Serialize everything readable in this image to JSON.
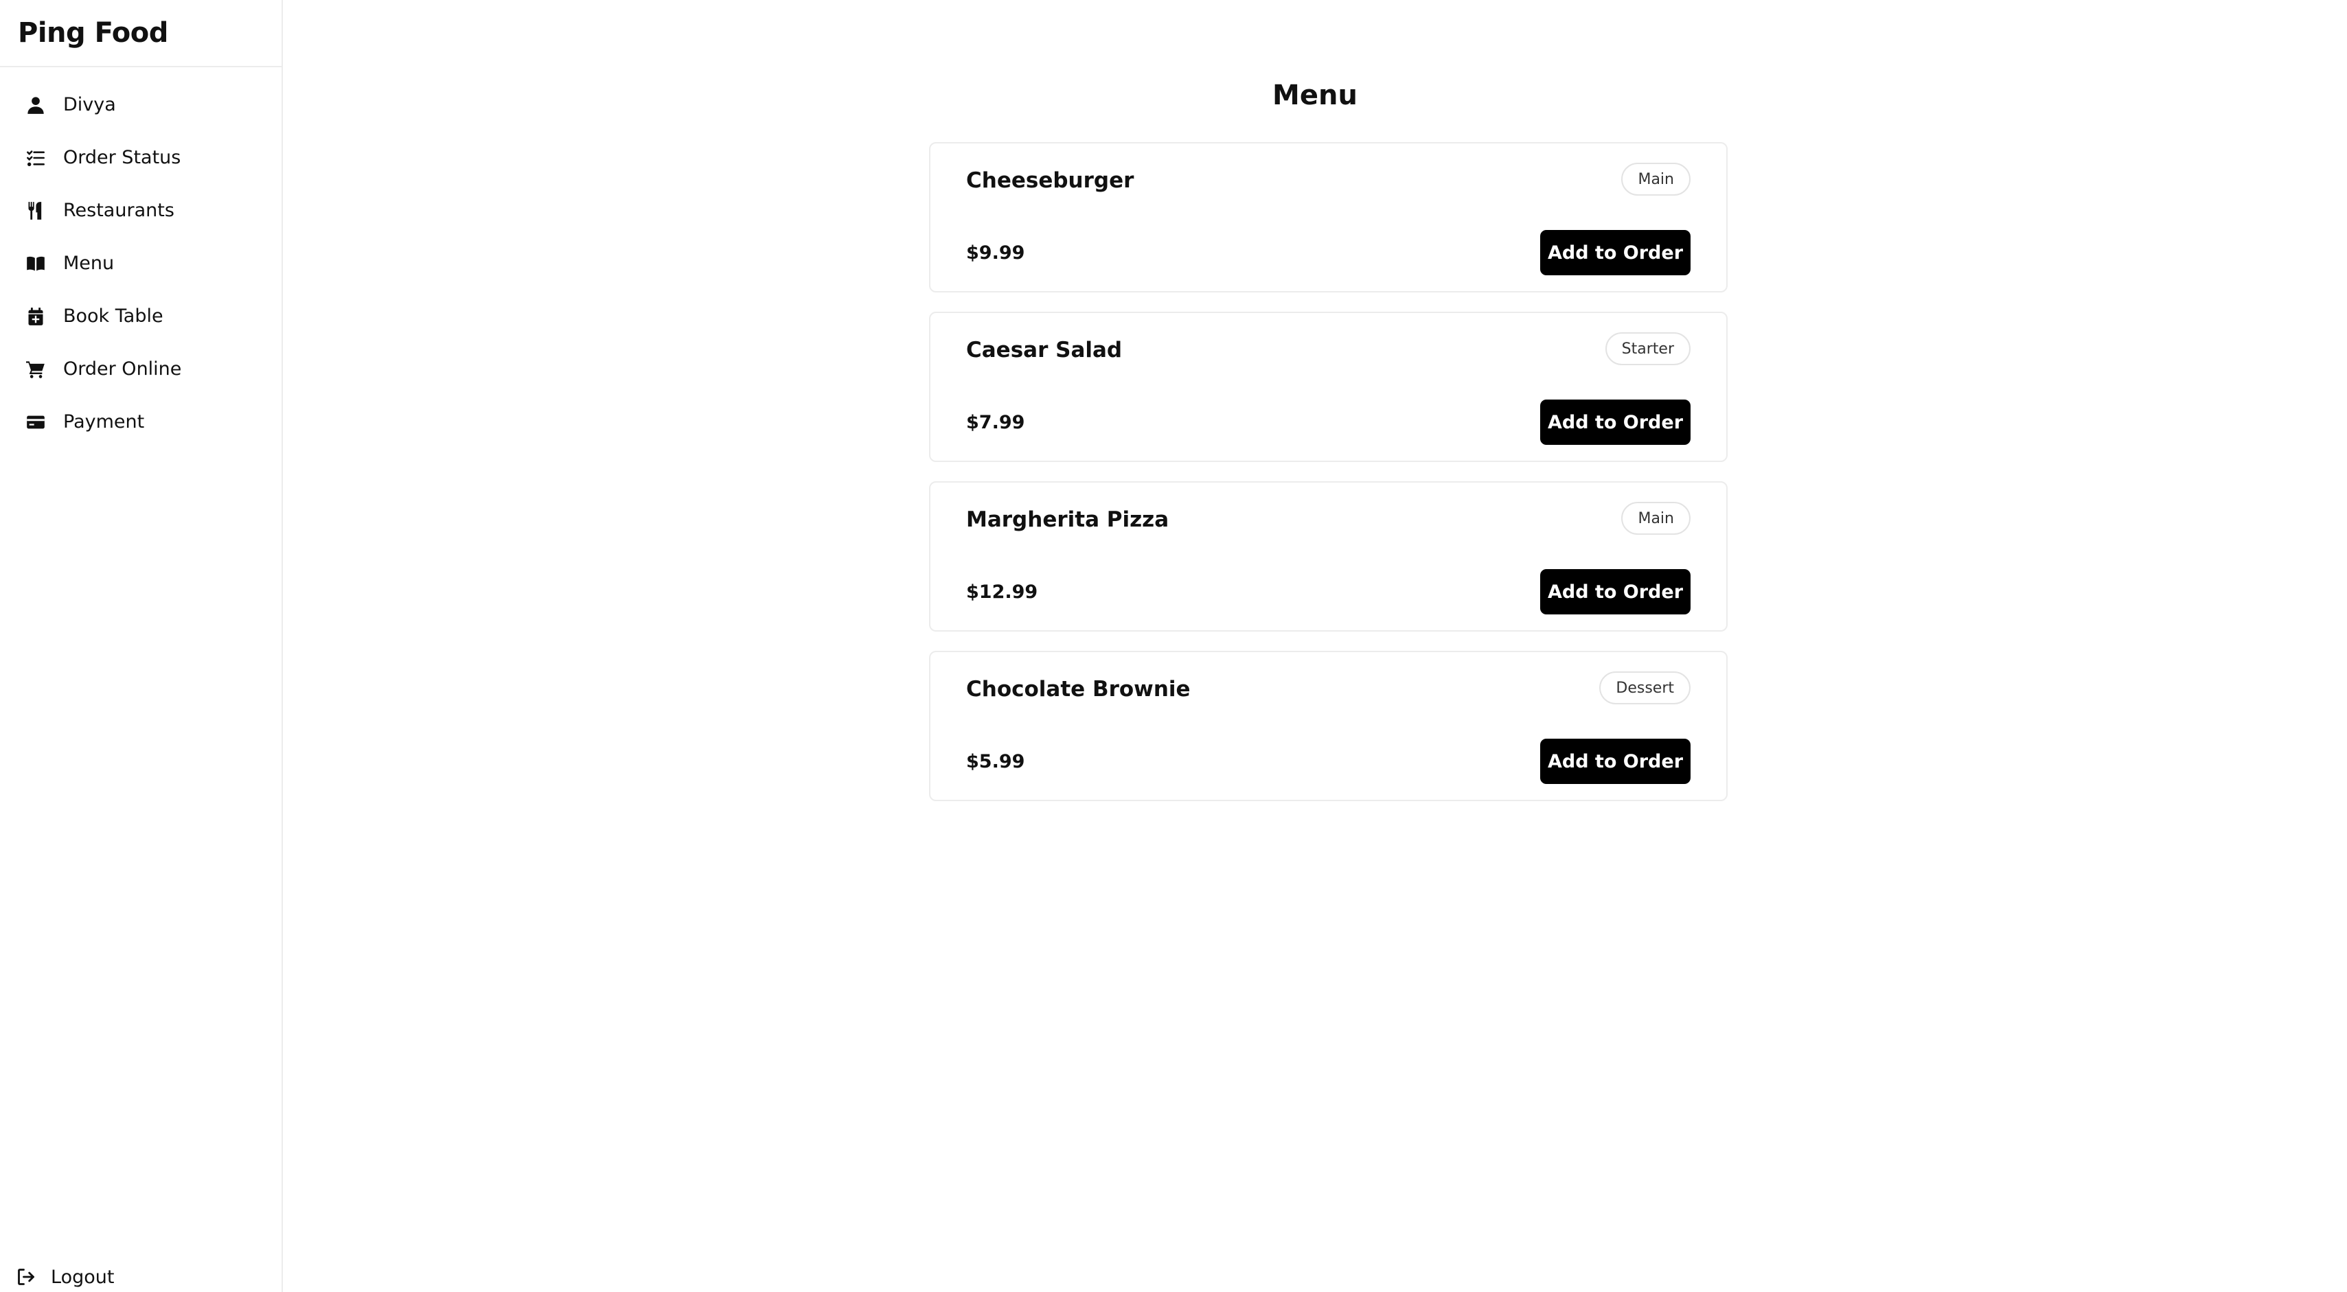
{
  "app": {
    "brand": "Ping Food"
  },
  "sidebar": {
    "items": [
      {
        "label": "Divya",
        "icon": "user-icon"
      },
      {
        "label": "Order Status",
        "icon": "list-check-icon"
      },
      {
        "label": "Restaurants",
        "icon": "utensils-icon"
      },
      {
        "label": "Menu",
        "icon": "book-open-icon"
      },
      {
        "label": "Book Table",
        "icon": "calendar-plus-icon"
      },
      {
        "label": "Order Online",
        "icon": "cart-icon"
      },
      {
        "label": "Payment",
        "icon": "credit-card-icon"
      }
    ],
    "logout": {
      "label": "Logout",
      "icon": "logout-icon"
    }
  },
  "main": {
    "title": "Menu",
    "items": [
      {
        "name": "Cheeseburger",
        "category": "Main",
        "price": "$9.99",
        "button": "Add to Order"
      },
      {
        "name": "Caesar Salad",
        "category": "Starter",
        "price": "$7.99",
        "button": "Add to Order"
      },
      {
        "name": "Margherita Pizza",
        "category": "Main",
        "price": "$12.99",
        "button": "Add to Order"
      },
      {
        "name": "Chocolate Brownie",
        "category": "Dessert",
        "price": "$5.99",
        "button": "Add to Order"
      }
    ]
  },
  "colors": {
    "primary": "#000000",
    "border": "#ececec",
    "text": "#111111"
  }
}
